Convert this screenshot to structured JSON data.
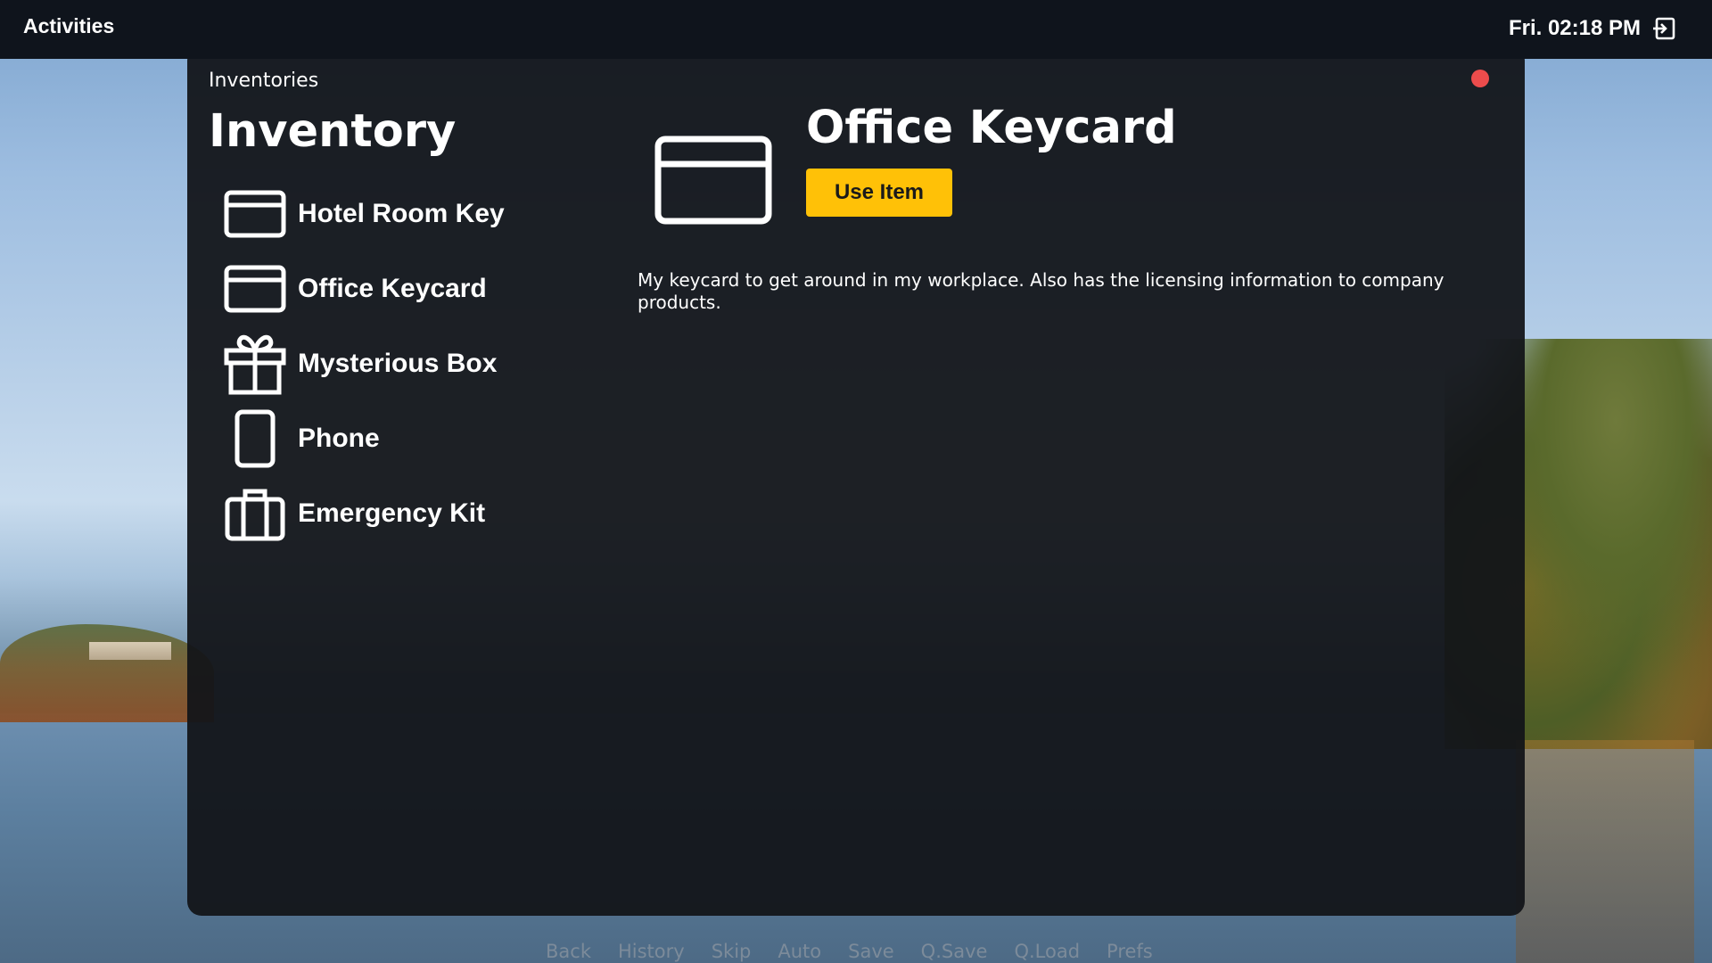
{
  "topbar": {
    "activities_label": "Activities",
    "clock": "Fri. 02:18 PM",
    "logout_icon": "logout-icon"
  },
  "window": {
    "title": "Inventories",
    "close_color": "#ec4c4c"
  },
  "inventory": {
    "heading": "Inventory",
    "items": [
      {
        "label": "Hotel Room Key",
        "icon": "card-icon"
      },
      {
        "label": "Office Keycard",
        "icon": "card-icon"
      },
      {
        "label": "Mysterious Box",
        "icon": "gift-icon"
      },
      {
        "label": "Phone",
        "icon": "phone-icon"
      },
      {
        "label": "Emergency Kit",
        "icon": "briefcase-icon"
      }
    ]
  },
  "detail": {
    "title": "Office Keycard",
    "icon": "card-icon",
    "use_button_label": "Use Item",
    "description": "My keycard to get around in my workplace. Also has the licensing information to company products.",
    "accent_color": "#ffc107"
  },
  "quick_menu": {
    "items": [
      "Back",
      "History",
      "Skip",
      "Auto",
      "Save",
      "Q.Save",
      "Q.Load",
      "Prefs"
    ]
  }
}
